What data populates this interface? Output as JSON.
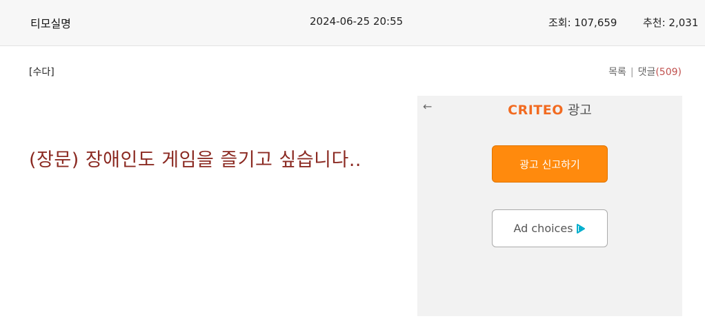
{
  "header": {
    "author": "티모실명",
    "datetime": "2024-06-25 20:55",
    "views": "조회: 107,659",
    "likes": "추천: 2,031"
  },
  "post": {
    "category": "[수다]",
    "list_link": "목록",
    "separator": "|",
    "comments_label": "댓글",
    "comments_count": "(509)",
    "title": "(장문) 장애인도 게임을 즐기고 싶습니다.."
  },
  "ad": {
    "back_icon": "←",
    "brand": "CRITEO",
    "label": "광고",
    "report_button": "광고 신고하기",
    "choices_button": "Ad choices",
    "accent_color": "#ff8a0d",
    "choices_icon_color": "#00aecd"
  }
}
